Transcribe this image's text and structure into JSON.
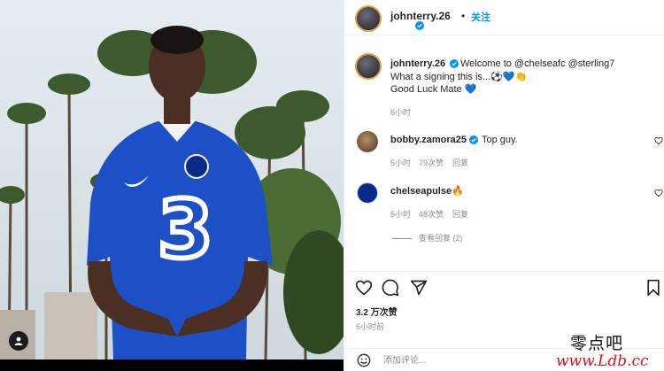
{
  "post": {
    "author": "johnterry.26",
    "follow_label": "关注",
    "caption_line1": "Welcome to @chelseafc @sterling7",
    "caption_line2": "What a signing this is...⚽💙👏",
    "caption_line3": "Good Luck Mate 💙",
    "caption_time": "6小时"
  },
  "comments": [
    {
      "user": "bobby.zamora25",
      "text": "Top guy.",
      "time": "5小时",
      "likes": "79次赞",
      "reply": "回复"
    },
    {
      "user": "chelseapulse",
      "text": "🔥",
      "time": "5小时",
      "likes": "48次赞",
      "reply": "回复"
    }
  ],
  "view_replies": "查看回复 (2)",
  "likes_count": "3.2 万次赞",
  "posted_ago": "6小时前",
  "comment_placeholder": "添加评论...",
  "watermark": {
    "title": "零点吧",
    "url": "www.Ldb.cc"
  },
  "icons": [
    "verified-badge",
    "more-icon",
    "heart-icon",
    "comment-icon",
    "share-icon",
    "bookmark-icon",
    "emoji-icon",
    "person-tag-icon"
  ],
  "colors": {
    "link": "#0095f6",
    "mention": "#00376b",
    "jersey": "#1d4fc7",
    "watermark_red": "#d8121e"
  }
}
